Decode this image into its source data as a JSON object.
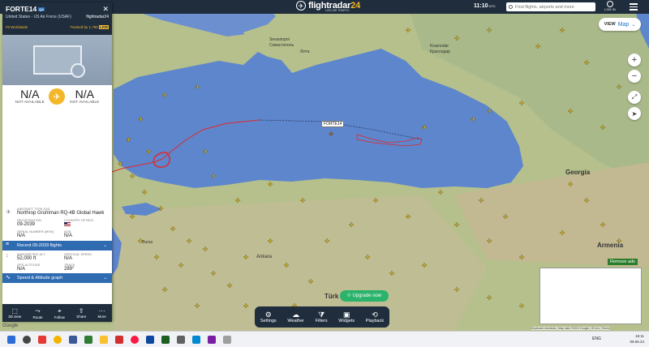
{
  "topbar": {
    "logo_text": "flightradar",
    "logo_suffix": "24",
    "logo_tagline": "LIVE AIR TRAFFIC",
    "time": "11:10",
    "time_zone": "UTC",
    "search_placeholder": "Find flights, airports and more",
    "login_label": "LOG IN"
  },
  "map_controls": {
    "view_label": "VIEW",
    "view_value": "Map"
  },
  "panel": {
    "callsign": "FORTE14",
    "callsign_badge": "Q4",
    "operator": "United States - US Air Force (USAF)",
    "brand": "flightradar24",
    "rank": "#3 Worldwide",
    "tracked": "Tracked by 1,796",
    "live_badge": "LIVE",
    "origin_code": "N/A",
    "origin_status": "NOT AVAILABLE",
    "dest_code": "N/A",
    "dest_status": "NOT AVAILABLE",
    "aircraft_type_label": "AIRCRAFT TYPE (Q4)",
    "aircraft_type": "Northrop Grumman RQ-4B Global Hawk",
    "registration_label": "REGISTRATION",
    "registration": "09-2039",
    "country_label": "COUNTRY OF REG.",
    "serial_label": "SERIAL NUMBER (MSN)",
    "serial": "N/A",
    "age_label": "AGE",
    "age": "N/A",
    "recent_flights": "Recent 09-2039 flights",
    "baro_alt_label": "BAROMETRIC ALT.",
    "baro_alt": "52,000 ft",
    "vspeed_label": "VERTICAL SPEED",
    "vspeed": "N/A",
    "gps_alt_label": "GPS ALTITUDE",
    "gps_alt": "N/A",
    "track_label": "TRACK",
    "track": "289°",
    "speed_graph": "Speed & Altitude graph",
    "bottom_buttons": [
      "3D view",
      "Route",
      "Follow",
      "Share",
      "More"
    ]
  },
  "flight_label": "FORTE14",
  "toolbar": {
    "buttons": [
      "Settings",
      "Weather",
      "Filters",
      "Widgets",
      "Playback"
    ],
    "upgrade": "Upgrade now"
  },
  "ads": {
    "remove_label": "Remove ads"
  },
  "map_labels": {
    "sevastopol": "Sevastopol",
    "sevastopol_ru": "Севастополь",
    "yalta": "Ялта",
    "krasnodar": "Krasnodar",
    "krasnodar_ru": "Краснодар",
    "georgia": "Georgia",
    "armenia": "Armenia",
    "ankara": "Ankara",
    "turkey": "Türk",
    "bursa": "Bursa"
  },
  "taskbar": {
    "lang": "ENG",
    "time": "15:11",
    "date": "09.06.24"
  },
  "attribution": "Keyboard shortcuts | Map data ©2024 Google | 50 km | Terms"
}
